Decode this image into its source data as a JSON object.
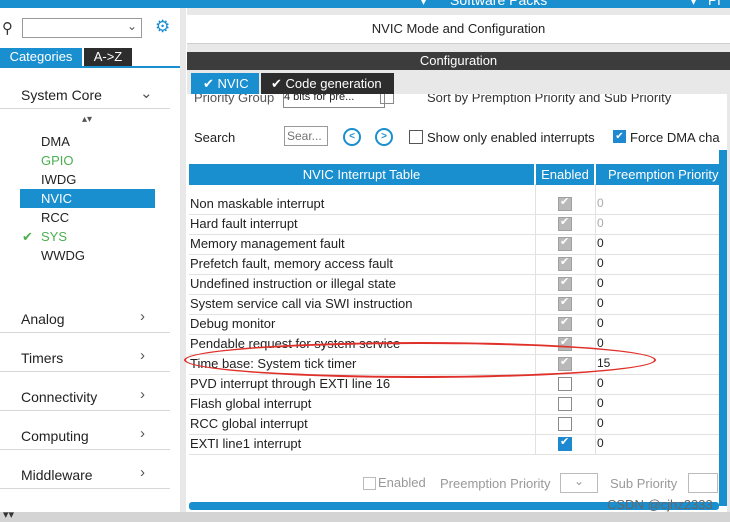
{
  "top_bar": {
    "software_packs": "Software Packs",
    "pinout": "Pi"
  },
  "left": {
    "tabs": {
      "categories": "Categories",
      "az": "A->Z"
    },
    "system_core": "System Core",
    "items": [
      "DMA",
      "GPIO",
      "IWDG",
      "NVIC",
      "RCC",
      "SYS",
      "WWDG"
    ],
    "categories": [
      "Analog",
      "Timers",
      "Connectivity",
      "Computing",
      "Middleware"
    ]
  },
  "main": {
    "title": "NVIC Mode and Configuration",
    "configuration": "Configuration",
    "tabs": [
      "NVIC",
      "Code generation"
    ],
    "priority_group_label": "Priority Group",
    "priority_group_value": "4 bits for pre...",
    "sort_label": "Sort by Premption Priority and Sub Priority",
    "search_label": "Search",
    "search_placeholder": "Sear...",
    "show_enabled_label": "Show only enabled interrupts",
    "force_dma_label": "Force DMA cha",
    "table_headers": [
      "NVIC Interrupt Table",
      "Enabled",
      "Preemption Priority"
    ],
    "rows": [
      {
        "name": "Non maskable interrupt",
        "enabled": "locked",
        "priority": "0"
      },
      {
        "name": "Hard fault interrupt",
        "enabled": "locked",
        "priority": "0"
      },
      {
        "name": "Memory management fault",
        "enabled": "locked",
        "priority": "0"
      },
      {
        "name": "Prefetch fault, memory access fault",
        "enabled": "locked",
        "priority": "0"
      },
      {
        "name": "Undefined instruction or illegal state",
        "enabled": "locked",
        "priority": "0"
      },
      {
        "name": "System service call via SWI instruction",
        "enabled": "locked",
        "priority": "0"
      },
      {
        "name": "Debug monitor",
        "enabled": "locked",
        "priority": "0"
      },
      {
        "name": "Pendable request for system service",
        "enabled": "locked",
        "priority": "0"
      },
      {
        "name": "Time base: System tick timer",
        "enabled": "locked",
        "priority": "15"
      },
      {
        "name": "PVD interrupt through EXTI line 16",
        "enabled": "off",
        "priority": "0"
      },
      {
        "name": "Flash global interrupt",
        "enabled": "off",
        "priority": "0"
      },
      {
        "name": "RCC global interrupt",
        "enabled": "off",
        "priority": "0"
      },
      {
        "name": "EXTI line1 interrupt",
        "enabled": "on",
        "priority": "0"
      }
    ],
    "bottom": {
      "enabled": "Enabled",
      "preemption": "Preemption Priority",
      "sub": "Sub Priority"
    }
  },
  "watermark": "CSDN @cjhz2333",
  "colors": {
    "accent": "#1a8fd0",
    "dark": "#2d2d2d",
    "highlight_circle": "#e0302a",
    "gpio": "#4caf50"
  }
}
